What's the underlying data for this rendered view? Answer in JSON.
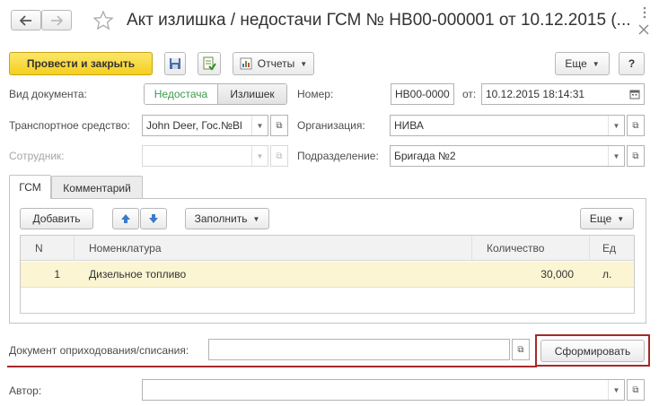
{
  "window": {
    "title": "Акт излишка / недостачи ГСМ № НВ00-000001 от 10.12.2015 (...",
    "back_icon": "arrow-left-icon",
    "forward_icon": "arrow-right-icon",
    "favorite_icon": "star-icon",
    "more_icon": "vertical-dots-icon",
    "close_icon": "close-icon"
  },
  "toolbar": {
    "post_close_label": "Провести и закрыть",
    "save_icon": "floppy-disk-icon",
    "post_icon": "post-document-icon",
    "reports_label": "Отчеты",
    "more_label": "Еще",
    "help_label": "?"
  },
  "form": {
    "doc_type_label": "Вид документа:",
    "doc_type_options": [
      "Недостача",
      "Излишек"
    ],
    "doc_type_selected": "Недостача",
    "number_label": "Номер:",
    "number_value": "НВ00-0000",
    "from_label": "от:",
    "date_value": "10.12.2015 18:14:31",
    "vehicle_label": "Транспортное средство:",
    "vehicle_value": "John Deer, Гос.№Bl",
    "org_label": "Организация:",
    "org_value": "НИВА",
    "employee_label": "Сотрудник:",
    "employee_value": "",
    "division_label": "Подразделение:",
    "division_value": "Бригада №2"
  },
  "tabs": [
    {
      "label": "ГСМ",
      "active": true
    },
    {
      "label": "Комментарий",
      "active": false
    }
  ],
  "table_toolbar": {
    "add_label": "Добавить",
    "fill_label": "Заполнить",
    "more_label": "Еще"
  },
  "table": {
    "columns": [
      "N",
      "Номенклатура",
      "Количество",
      "Ед"
    ],
    "rows": [
      {
        "n": "1",
        "item": "Дизельное топливо",
        "qty": "30,000",
        "unit": "л."
      }
    ]
  },
  "footer": {
    "doc_link_label": "Документ оприходования/списания:",
    "doc_link_value": "",
    "generate_label": "Сформировать",
    "author_label": "Автор:",
    "author_value": ""
  },
  "colors": {
    "accent_yellow": "#f5cf1f",
    "selected_row": "#fbf5d3",
    "highlight_red": "#a52a2a",
    "active_toggle_text": "#3c9a4a"
  }
}
